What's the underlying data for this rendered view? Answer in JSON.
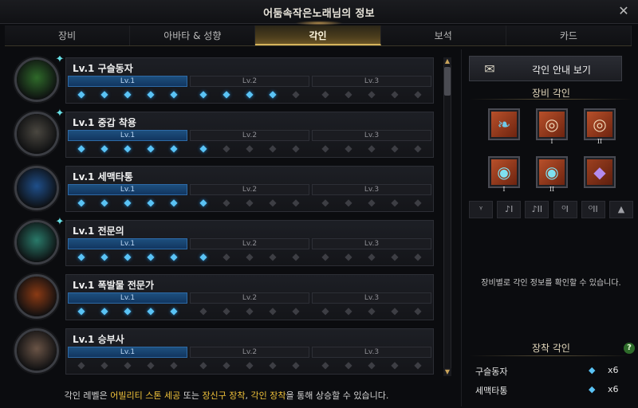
{
  "window": {
    "title": "어둠속작은노래님의 정보",
    "close_label": "✕"
  },
  "tabs": [
    {
      "label": "장비",
      "active": false
    },
    {
      "label": "아바타 & 성향",
      "active": false
    },
    {
      "label": "각인",
      "active": true
    },
    {
      "label": "보석",
      "active": false
    },
    {
      "label": "카드",
      "active": false
    }
  ],
  "level_labels": [
    "Lv.1",
    "Lv.2",
    "Lv.3"
  ],
  "engravings": [
    {
      "name": "Lv.1 구슬동자",
      "filled_gems": 9,
      "portrait_color": "#2f6a2a",
      "has_gem_badge": true
    },
    {
      "name": "Lv.1 중갑 착용",
      "filled_gems": 6,
      "portrait_color": "#4a4740",
      "has_gem_badge": true
    },
    {
      "name": "Lv.1 세맥타통",
      "filled_gems": 6,
      "portrait_color": "#1f4f8a",
      "has_gem_badge": false
    },
    {
      "name": "Lv.1 전문의",
      "filled_gems": 6,
      "portrait_color": "#2a7a6a",
      "has_gem_badge": true
    },
    {
      "name": "Lv.1 폭발물 전문가",
      "filled_gems": 5,
      "portrait_color": "#8a3a14",
      "has_gem_badge": false
    },
    {
      "name": "Lv.1 승부사",
      "filled_gems": 0,
      "portrait_color": "#6a5446",
      "has_gem_badge": false
    }
  ],
  "hint": {
    "prefix": "각인 레벨은 ",
    "hl1": "어빌리티 스톤 세공",
    "mid1": " 또는 ",
    "hl2": "장신구 장착",
    "mid2": ", ",
    "hl3": "각인 장착",
    "suffix": "을 통해 상승할 수 있습니다."
  },
  "right_panel": {
    "guide_button_label": "각인 안내 보기",
    "equip_section_title": "장비 각인",
    "equip_slots": [
      {
        "item": "necklace-icon",
        "glyph": "❧",
        "tier": ""
      },
      {
        "item": "earring-icon",
        "glyph": "◎",
        "tier": "I"
      },
      {
        "item": "earring-icon",
        "glyph": "◎",
        "tier": "II"
      },
      {
        "item": "ring-icon",
        "glyph": "◉",
        "tier": "I"
      },
      {
        "item": "ring-icon",
        "glyph": "◉",
        "tier": "II"
      },
      {
        "item": "ability-stone-icon",
        "glyph": "◆",
        "tier": ""
      }
    ],
    "equip_type_icons": [
      "ᵞ",
      "♪I",
      "♪II",
      "ᴼI",
      "ᴼII",
      "▲"
    ],
    "info_text": "장비별로 각인 정보를 확인할 수 있습니다.",
    "mounted_section_title": "장착 각인",
    "help_label": "?",
    "mounted": [
      {
        "name": "구슬동자",
        "count": "x6"
      },
      {
        "name": "세맥타통",
        "count": "x6"
      }
    ]
  },
  "colors": {
    "accent_gold": "#d6b45c",
    "gem_blue": "#5ac3f5",
    "highlight_yellow": "#f0c23a",
    "level_bar_active": "#1d4f7e"
  }
}
